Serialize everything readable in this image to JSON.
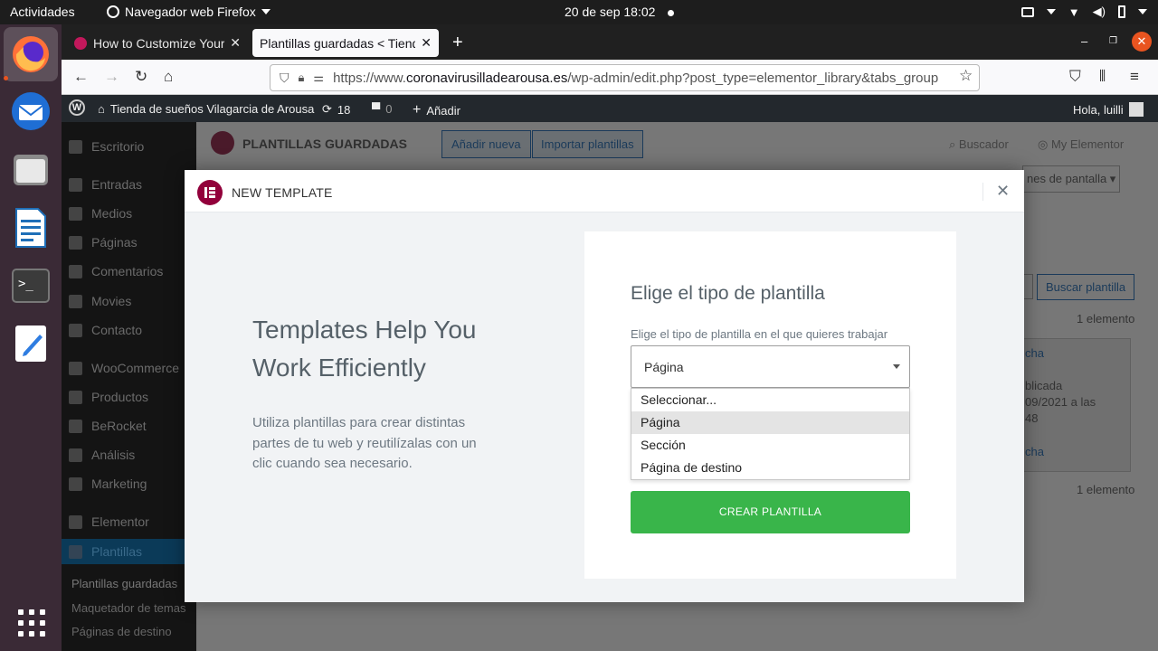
{
  "topbar": {
    "activities": "Actividades",
    "app_name": "Navegador web Firefox",
    "clock": "20 de sep  18:02"
  },
  "dock": {
    "items": [
      "firefox-icon",
      "thunderbird-icon",
      "files-icon",
      "writer-icon",
      "terminal-icon",
      "text-editor-icon"
    ],
    "grid": "show-apps-icon"
  },
  "browser": {
    "tabs": [
      {
        "title": "How to Customize Your W"
      },
      {
        "title": "Plantillas guardadas < Tiend"
      }
    ],
    "url_prefix": "https://www.",
    "url_host": "coronavirusilladearousa.es",
    "url_path": "/wp-admin/edit.php?post_type=elementor_library&tabs_group"
  },
  "adminbar": {
    "site": "Tienda de sueños Vilagarcia de Arousa",
    "updates": "18",
    "comments": "0",
    "add": "Añadir",
    "greeting": "Hola, luilli"
  },
  "wp": {
    "sidebar": [
      "Escritorio",
      "Entradas",
      "Medios",
      "Páginas",
      "Comentarios",
      "Movies",
      "Contacto",
      "WooCommerce",
      "Productos",
      "BeRocket",
      "Análisis",
      "Marketing",
      "Elementor",
      "Plantillas"
    ],
    "submenu": [
      "Plantillas guardadas",
      "Maquetador de temas",
      "Páginas de destino"
    ],
    "page_title": "PLANTILLAS GUARDADAS",
    "add_new": "Añadir nueva",
    "import": "Importar plantillas",
    "search": "Buscador",
    "my_elementor": "My Elementor",
    "screen_options": "nes de pantalla",
    "search_template": "Buscar plantilla",
    "count": "1 elemento",
    "col_date": "cha",
    "published": "blicada",
    "date_line": "09/2021 a las",
    "time_line": "48"
  },
  "modal": {
    "title": "NEW TEMPLATE",
    "logo": "E",
    "intro_title": "Templates Help You Work Efficiently",
    "intro_text": "Utiliza plantillas para crear distintas partes de tu web y reutilízalas con un clic cuando sea necesario.",
    "form_title": "Elige el tipo de plantilla",
    "form_label": "Elige el tipo de plantilla en el que quieres trabajar",
    "selected": "Página",
    "options": [
      "Seleccionar...",
      "Página",
      "Sección",
      "Página de destino"
    ],
    "create_button": "CREAR PLANTILLA"
  },
  "colors": {
    "elementor": "#92003b",
    "create_button": "#39b54a",
    "ubuntu_orange": "#e95420"
  }
}
